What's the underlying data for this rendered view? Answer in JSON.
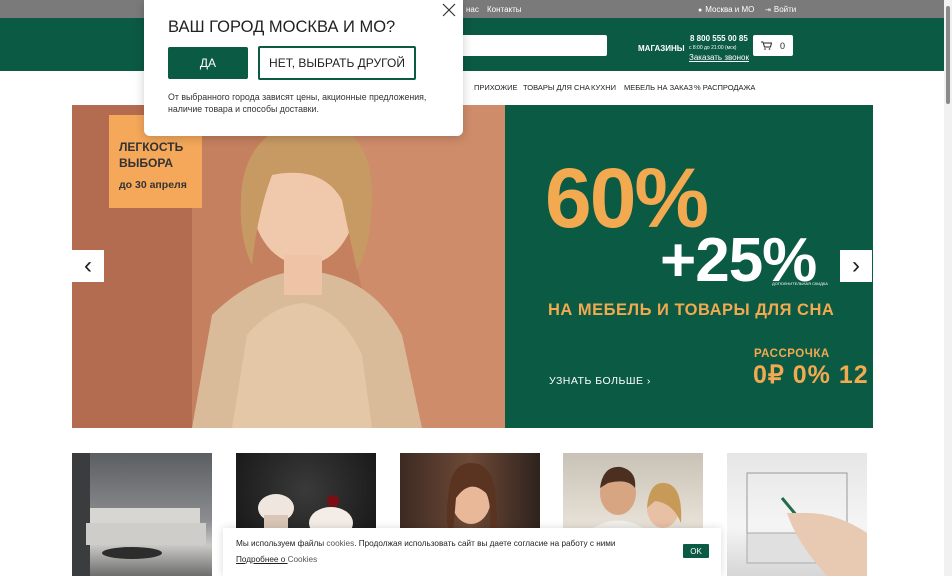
{
  "topbar": {
    "about_tail": "нас",
    "contacts": "Контакты",
    "city": "Москва и МО",
    "login": "Войти"
  },
  "header": {
    "shops": "МАГАЗИНЫ",
    "phone": "8 800 555 00 85",
    "hours": "с 8:00 до 21:00 (мск)",
    "callback": "Заказать звонок",
    "cart_count": "0"
  },
  "nav": {
    "items": [
      "ПРИХОЖИЕ",
      "ТОВАРЫ ДЛЯ СНА",
      "КУХНИ",
      "МЕБЕЛЬ НА ЗАКАЗ",
      "% РАСПРОДАЖА"
    ]
  },
  "banner": {
    "promo_title": "ЛЕГКОСТЬ\nВЫБОРА",
    "promo_date": "до 30 апреля",
    "big_percent": "60%",
    "plus_percent": "+25%",
    "extra_discount": "ДОПОЛНИТЕЛЬНАЯ СКИДКА",
    "subtitle": "НА МЕБЕЛЬ И ТОВАРЫ ДЛЯ СНА",
    "learn_more": "УЗНАТЬ БОЛЬШЕ ›",
    "installment_label": "РАССРОЧКА",
    "installment_values": "0₽ 0% 12"
  },
  "modal": {
    "title": "ВАШ ГОРОД МОСКВА И МО?",
    "yes": "ДА",
    "choose_other": "НЕТ, ВЫБРАТЬ ДРУГОЙ",
    "note": "От выбранного города зависят цены, акционные предложения, наличие товара и способы доставки."
  },
  "cookie": {
    "text_before": "Мы используем файлы ",
    "text_link": "cookies",
    "text_after": ". Продолжая использовать сайт вы даете согласие на работу с ними",
    "more_prefix": "Подробнее о ",
    "more_link": "Cookies",
    "ok": "OK"
  },
  "colors": {
    "brand_green": "#0b5a43",
    "accent_orange": "#f2a950",
    "topbar_gray": "#7a7a7a"
  }
}
